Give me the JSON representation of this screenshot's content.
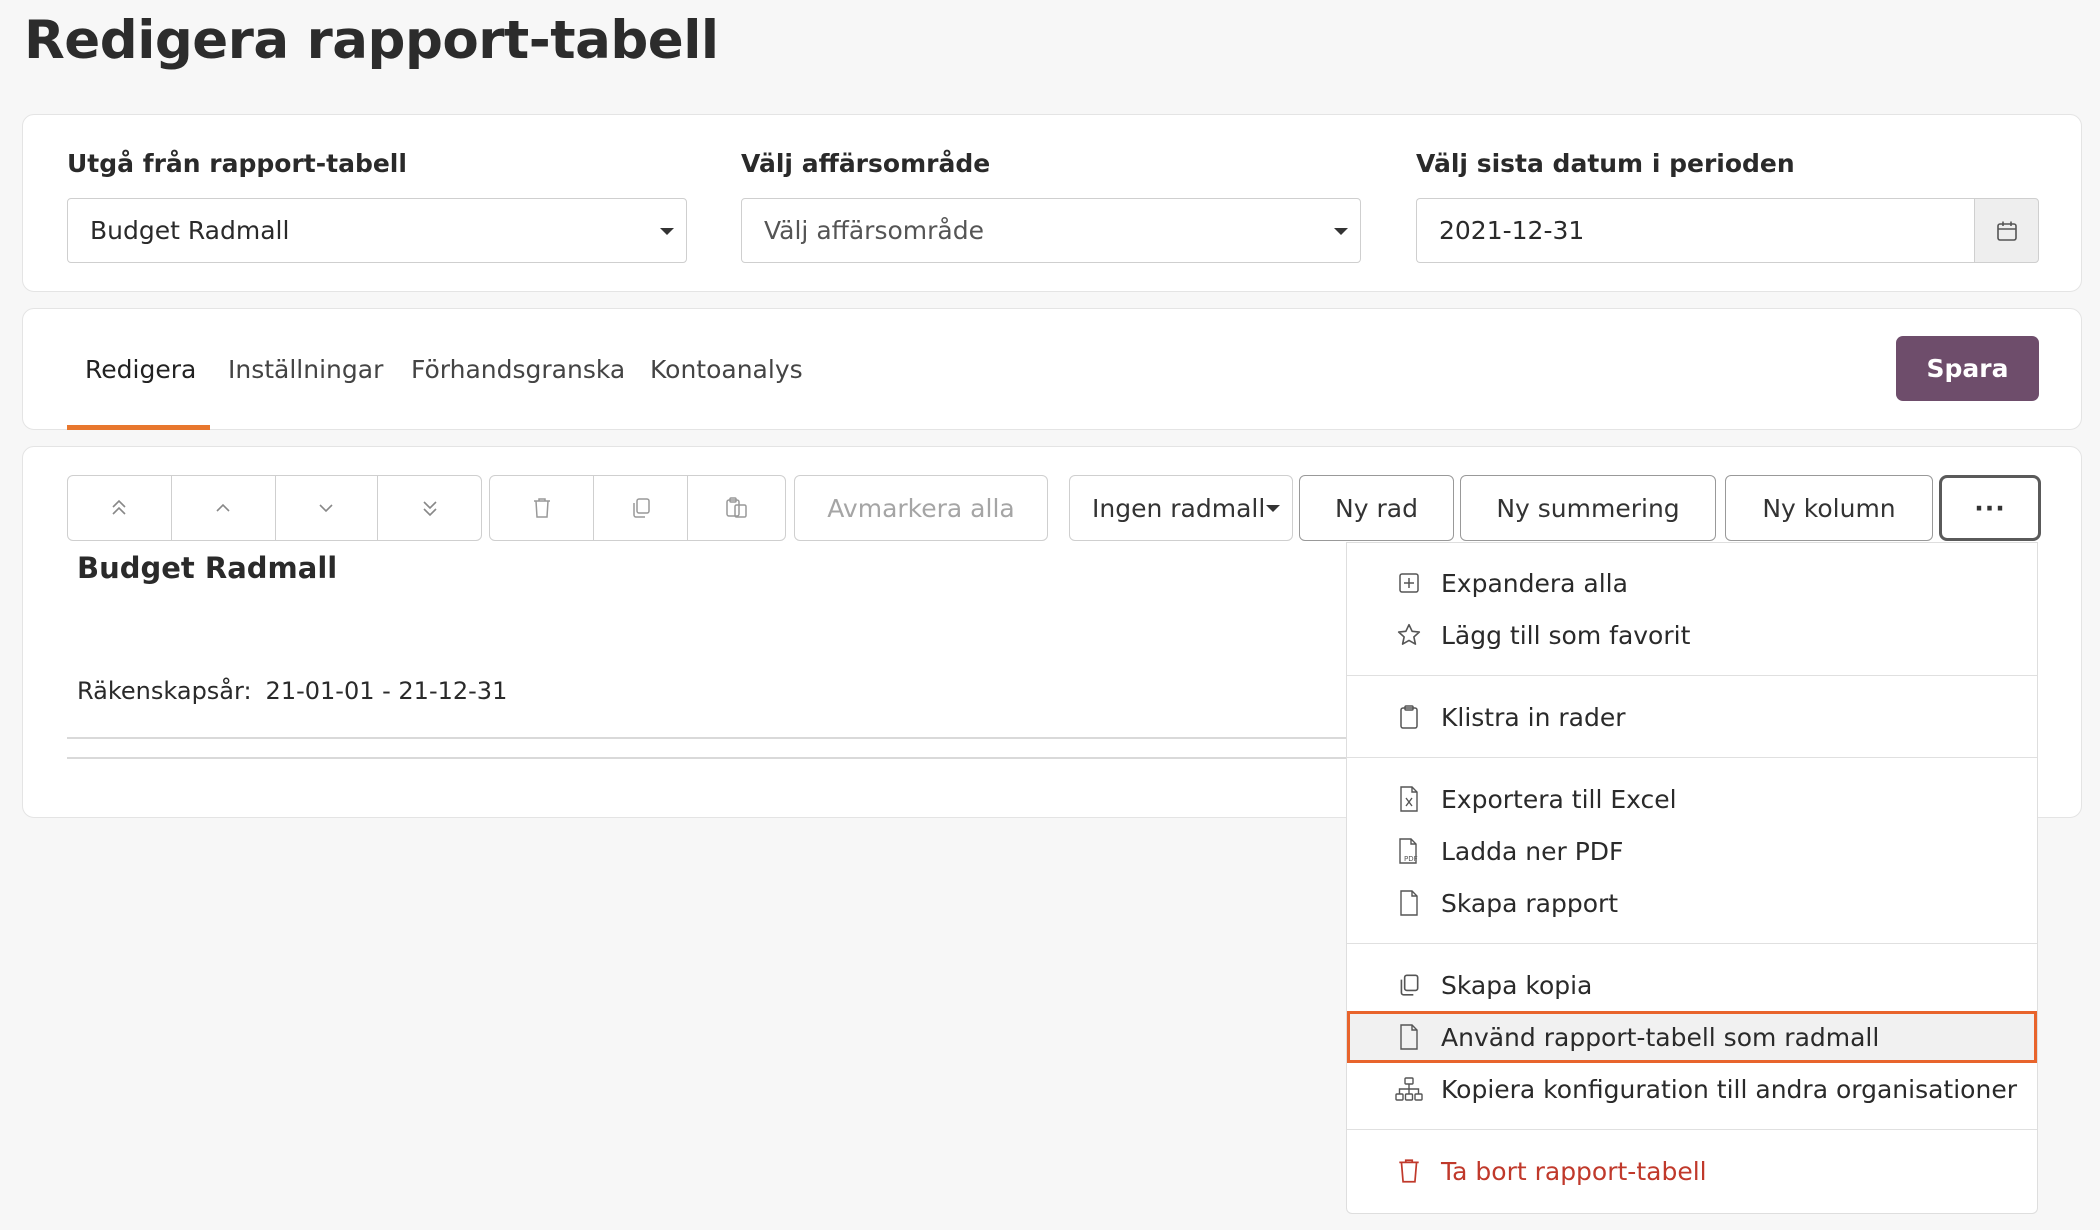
{
  "page": {
    "title": "Redigera rapport-tabell"
  },
  "filters": {
    "source_label": "Utgå från rapport-tabell",
    "source_value": "Budget Radmall",
    "area_label": "Välj affärsområde",
    "area_value": "Välj affärsområde",
    "date_label": "Välj sista datum i perioden",
    "date_value": "2021-12-31"
  },
  "tabs": [
    {
      "label": "Redigera",
      "active": true
    },
    {
      "label": "Inställningar",
      "active": false
    },
    {
      "label": "Förhandsgranska",
      "active": false
    },
    {
      "label": "Kontoanalys",
      "active": false
    }
  ],
  "actions": {
    "save": "Spara"
  },
  "toolbar": {
    "deselect_all": "Avmarkera alla",
    "row_template": "Ingen radmall",
    "new_row": "Ny rad",
    "new_summation": "Ny summering",
    "new_column": "Ny kolumn",
    "more": "···"
  },
  "report": {
    "title": "Budget Radmall",
    "fiscal_label": "Räkenskapsår:",
    "fiscal_value": "21-01-01 - 21-12-31"
  },
  "menu": {
    "items": [
      {
        "label": "Expandera alla",
        "icon": "plus-square-icon"
      },
      {
        "label": "Lägg till som favorit",
        "icon": "star-icon"
      },
      {
        "label": "Klistra in rader",
        "icon": "clipboard-icon"
      },
      {
        "label": "Exportera till Excel",
        "icon": "excel-file-icon"
      },
      {
        "label": "Ladda ner PDF",
        "icon": "pdf-file-icon"
      },
      {
        "label": "Skapa rapport",
        "icon": "file-icon"
      },
      {
        "label": "Skapa kopia",
        "icon": "copy-icon"
      },
      {
        "label": "Använd rapport-tabell som radmall",
        "icon": "file-icon"
      },
      {
        "label": "Kopiera konfiguration till andra organisationer",
        "icon": "org-tree-icon"
      },
      {
        "label": "Ta bort rapport-tabell",
        "icon": "trash-icon"
      }
    ]
  },
  "colors": {
    "accent": "#e8772e",
    "primary": "#6e4d6b",
    "danger": "#c0392b",
    "highlight_border": "#e8642c"
  }
}
